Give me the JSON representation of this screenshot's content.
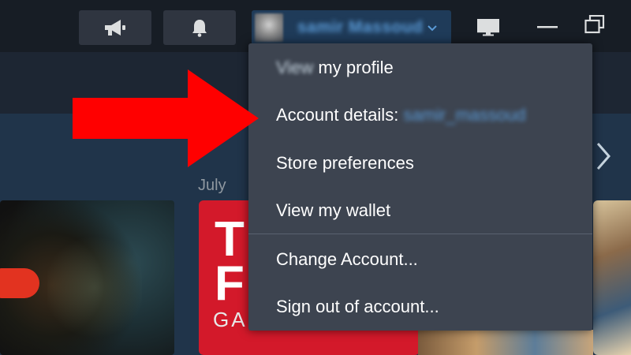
{
  "topbar": {
    "announce_icon": "megaphone-icon",
    "notify_icon": "bell-icon",
    "user": {
      "name": "samir Massoud",
      "caret_icon": "chevron-down-icon"
    },
    "window_icons": [
      "monitor-icon",
      "minimize-icon",
      "restore-icon"
    ]
  },
  "content": {
    "month_label": "July",
    "next_icon": "chevron-right-icon",
    "featured_mid": {
      "title_lines": [
        "TH",
        "FI"
      ],
      "subtitle": "GA"
    }
  },
  "account_menu": {
    "items": [
      {
        "label_prefix": "View",
        "label_rest": " my profile"
      },
      {
        "label": "Account details:",
        "handle": "samir_massoud"
      },
      {
        "label": "Store preferences"
      },
      {
        "label": "View my wallet"
      },
      {
        "label": "Change Account..."
      },
      {
        "label": "Sign out of account..."
      }
    ]
  },
  "colors": {
    "background": "#1b2838",
    "menu_bg": "#3d4450",
    "accent_blue": "#5a9ad6",
    "annotation_red": "#ff0000",
    "featured_red": "#d3192a"
  }
}
